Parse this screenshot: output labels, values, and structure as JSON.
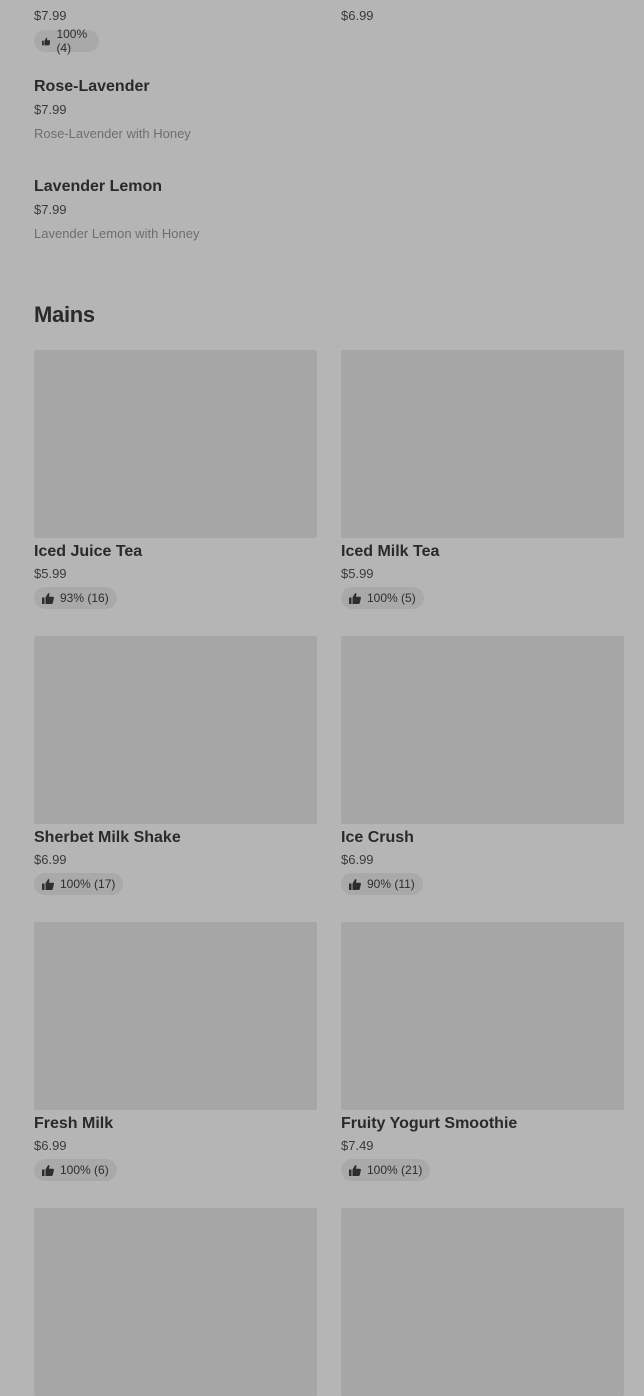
{
  "top_items": [
    {
      "name": "",
      "price": "$7.99",
      "rating": "100% (4)"
    },
    {
      "name": "",
      "price": "$6.99",
      "rating": ""
    }
  ],
  "text_items": [
    {
      "name": "Rose-Lavender",
      "price": "$7.99",
      "description": "Rose-Lavender with Honey"
    },
    {
      "name": "Lavender Lemon",
      "price": "$7.99",
      "description": "Lavender Lemon with Honey"
    }
  ],
  "section": {
    "title": "Mains"
  },
  "cards": [
    {
      "name": "Iced Juice Tea",
      "price": "$5.99",
      "rating": "93% (16)"
    },
    {
      "name": "Iced Milk Tea",
      "price": "$5.99",
      "rating": "100% (5)"
    },
    {
      "name": "Sherbet Milk Shake",
      "price": "$6.99",
      "rating": "100% (17)"
    },
    {
      "name": "Ice Crush",
      "price": "$6.99",
      "rating": "90% (11)"
    },
    {
      "name": "Fresh Milk",
      "price": "$6.99",
      "rating": "100% (6)"
    },
    {
      "name": "Fruity Yogurt Smoothie",
      "price": "$7.49",
      "rating": "100% (21)"
    },
    {
      "name": "",
      "price": "",
      "rating": ""
    },
    {
      "name": "",
      "price": "",
      "rating": ""
    }
  ],
  "icons": {
    "rating": "thumbs-up-icon"
  },
  "colors": {
    "background": "#b5b5b5",
    "image_placeholder": "#a6a6a6",
    "rating_pill": "#a9a9a9"
  }
}
